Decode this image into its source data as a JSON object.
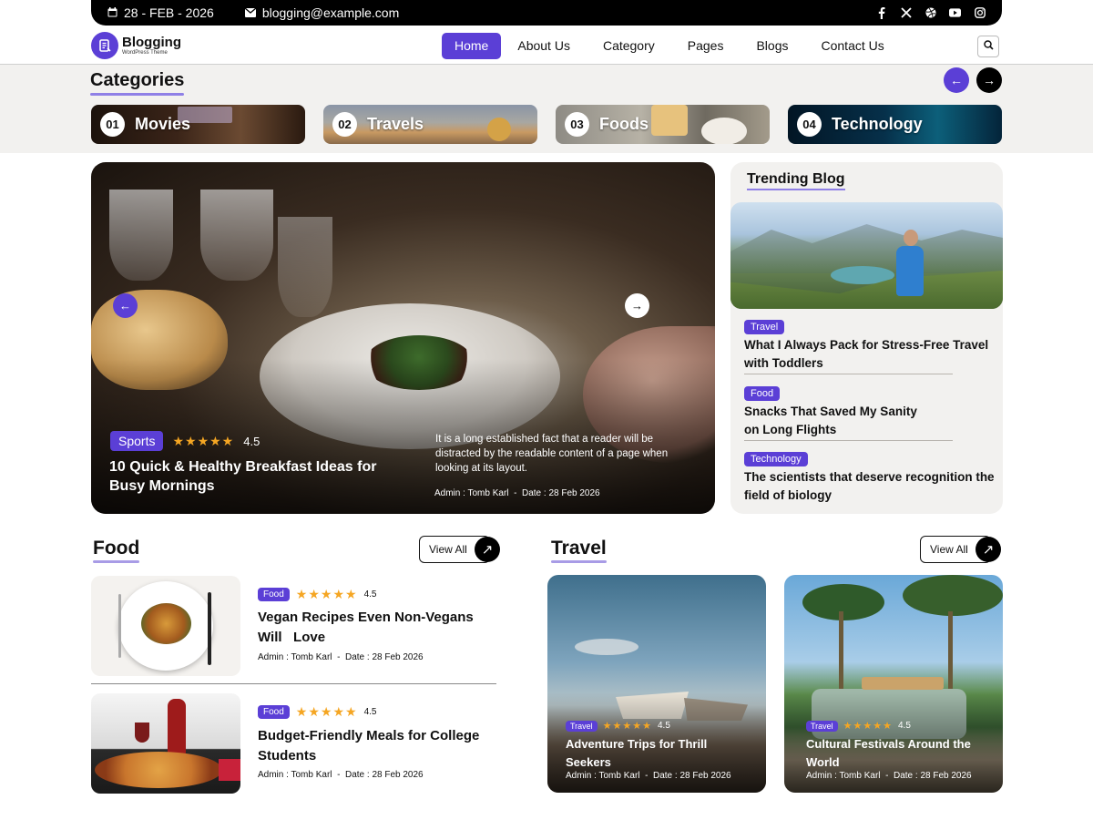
{
  "colors": {
    "accent": "#5b3fd6",
    "accent_light": "#8f80e6",
    "dark": "#000000",
    "band": "#f2f1ef",
    "star": "#f5a623"
  },
  "topbar": {
    "date": "28 - FEB - 2026",
    "email": "blogging@example.com",
    "social_icons": [
      "facebook-icon",
      "x-icon",
      "dribbble-icon",
      "youtube-icon",
      "instagram-icon"
    ]
  },
  "brand": {
    "name": "Blogging",
    "tagline": "WordPress Theme"
  },
  "nav": {
    "items": [
      {
        "label": "Home",
        "active": true
      },
      {
        "label": "About Us"
      },
      {
        "label": "Category"
      },
      {
        "label": "Pages"
      },
      {
        "label": "Blogs"
      },
      {
        "label": "Contact Us"
      }
    ]
  },
  "categories": {
    "title": "Categories",
    "items": [
      {
        "num": "01",
        "name": "Movies"
      },
      {
        "num": "02",
        "name": "Travels"
      },
      {
        "num": "03",
        "name": "Foods"
      },
      {
        "num": "04",
        "name": "Technology"
      }
    ]
  },
  "hero": {
    "badge": "Sports",
    "rating": "4.5",
    "title": "10 Quick & Healthy Breakfast Ideas for Busy Mornings",
    "description": "It is a long established fact that a reader will be distracted by the readable content of a page when looking at its layout.",
    "author": "Admin : Tomb Karl",
    "sep": "-",
    "date": "Date : 28  Feb 2026"
  },
  "trending": {
    "title": "Trending Blog",
    "items": [
      {
        "badge": "Travel",
        "title": "What I Always Pack for Stress-Free Travel with Toddlers"
      },
      {
        "badge": "Food",
        "title": "Snacks That Saved My Sanity on Long Flights"
      },
      {
        "badge": "Technology",
        "title": "The scientists that deserve recognition the field of biology"
      }
    ]
  },
  "food": {
    "title": "Food",
    "view_all": "View All",
    "posts": [
      {
        "badge": "Food",
        "rating": "4.5",
        "title": "Vegan Recipes Even Non-Vegans Will   Love",
        "author": "Admin : Tomb Karl",
        "sep": "-",
        "date": "Date : 28  Feb 2026"
      },
      {
        "badge": "Food",
        "rating": "4.5",
        "title": "Budget-Friendly Meals for College Students",
        "author": "Admin : Tomb Karl",
        "sep": "-",
        "date": "Date : 28  Feb 2026"
      }
    ]
  },
  "travel": {
    "title": "Travel",
    "view_all": "View All",
    "posts": [
      {
        "badge": "Travel",
        "rating": "4.5",
        "title": "Adventure Trips for Thrill Seekers",
        "author": "Admin : Tomb Karl",
        "sep": "-",
        "date": "Date : 28  Feb 2026"
      },
      {
        "badge": "Travel",
        "rating": "4.5",
        "title": "Cultural Festivals Around the World",
        "author": "Admin : Tomb Karl",
        "sep": "-",
        "date": "Date : 28  Feb 2026"
      }
    ]
  },
  "stars": "★★★★★"
}
